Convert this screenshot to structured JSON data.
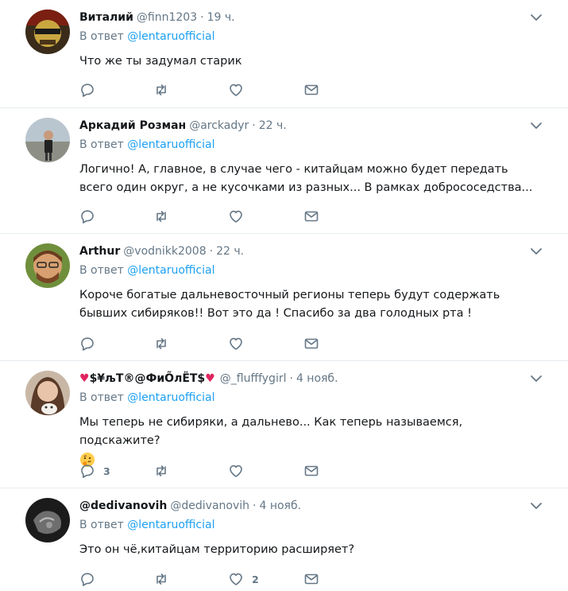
{
  "tweets": [
    {
      "name": "Виталий",
      "handle": "@finn1203",
      "time": "19 ч.",
      "reply_prefix": "В ответ",
      "reply_to": "@lentaruofficial",
      "text": "Что же ты задумал старик",
      "replies": "",
      "likes": ""
    },
    {
      "name": "Аркадий Розман",
      "handle": "@arckadyr",
      "time": "22 ч.",
      "reply_prefix": "В ответ",
      "reply_to": "@lentaruofficial",
      "text": "Логично! А, главное, в случае чего - китайцам можно будет передать всего один округ, а не кусочками из разных... В рамках добрососедства...",
      "replies": "",
      "likes": ""
    },
    {
      "name": "Arthur",
      "handle": "@vodnikk2008",
      "time": "22 ч.",
      "reply_prefix": "В ответ",
      "reply_to": "@lentaruofficial",
      "text": "Короче богатые дальневосточный регионы теперь будут содержать бывших сибиряков!! Вот это да ! Спасибо за два голодных рта !",
      "replies": "",
      "likes": ""
    },
    {
      "name": "$¥љТ®@ФиÕлЁТ$",
      "handle": "@_flufffygirl",
      "time": "4 нояб.",
      "reply_prefix": "В ответ",
      "reply_to": "@lentaruofficial",
      "text": "Мы теперь не сибиряки, а дальнево... Как теперь называемся, подскажите?",
      "replies": "3",
      "likes": ""
    },
    {
      "name": "@dedivanovih",
      "handle": "@dedivanovih",
      "time": "4 нояб.",
      "reply_prefix": "В ответ",
      "reply_to": "@lentaruofficial",
      "text": "Это он чё,китайцам территорию расширяет?",
      "replies": "",
      "likes": "2"
    }
  ],
  "icons": {
    "reply": "reply-icon",
    "retweet": "retweet-icon",
    "like": "heart-icon",
    "dm": "envelope-icon",
    "caret": "chevron-down-icon",
    "thinking": "thinking-face-emoji"
  },
  "colors": {
    "link": "#1da1f2",
    "muted": "#657786",
    "text": "#14171a",
    "divider": "#e6ecf0",
    "heart": "#e0245e"
  }
}
